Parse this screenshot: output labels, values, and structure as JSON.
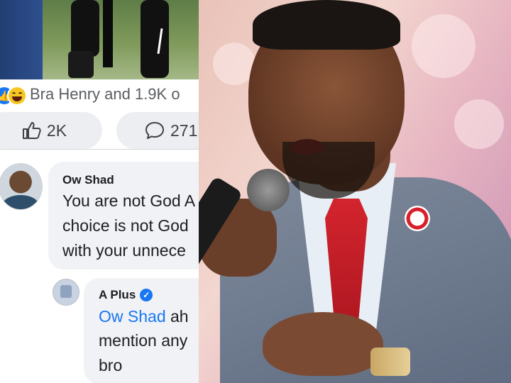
{
  "post": {
    "reactions_text": "Bra Henry and 1.9K o",
    "like_count": "2K",
    "comment_count": "271"
  },
  "comments": [
    {
      "author": "Ow Shad",
      "lines": [
        "You are not God A",
        "choice is not God",
        "with your unnece"
      ]
    },
    {
      "author": "A Plus",
      "verified": true,
      "mention": "Ow Shad",
      "first_line_rest": " ah",
      "lines": [
        "mention any",
        "bro"
      ]
    }
  ],
  "colors": {
    "facebook_blue": "#1877f2",
    "bubble_gray": "#f0f2f5",
    "tie_red": "#d3242e"
  },
  "icons": [
    "like-icon",
    "haha-icon",
    "thumbs-up-icon",
    "comment-icon",
    "verified-badge-icon"
  ]
}
